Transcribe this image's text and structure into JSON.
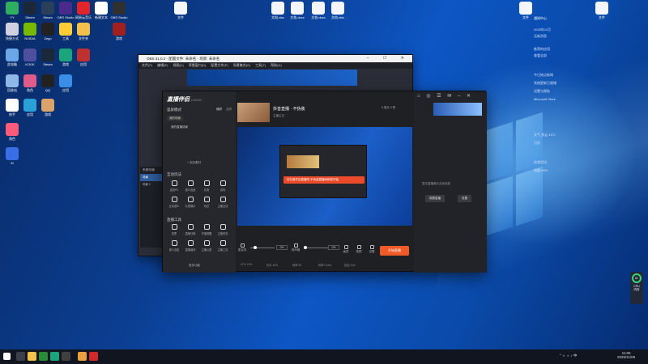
{
  "colors": {
    "accent": "#f05a28",
    "desktop": "#0d56c4",
    "obs_bg": "#2b2e38",
    "helper_bg": "#1f2024"
  },
  "desktop_icons": [
    {
      "label": "YY",
      "color": "#2fae5f"
    },
    {
      "label": "Steam",
      "color": "#1b2838"
    },
    {
      "label": "Steam",
      "color": "#2a3f5a"
    },
    {
      "label": "OBS Studio",
      "color": "#4a2a8a"
    },
    {
      "label": "网易云音乐",
      "color": "#e0262a"
    },
    {
      "label": "新建文本",
      "color": "#ffffff"
    },
    {
      "label": "OBS Studio",
      "color": "#303030"
    },
    {
      "label": "快捷方式",
      "color": "#d0d0e0"
    },
    {
      "label": "NVIDIA",
      "color": "#76b900"
    },
    {
      "label": "Zepp",
      "color": "#222"
    },
    {
      "label": "工具",
      "color": "#ffcc33"
    },
    {
      "label": "文件夹",
      "color": "#f3c14b"
    },
    {
      "label": "游戏",
      "color": "#a02020"
    },
    {
      "label": "此电脑",
      "color": "#6aa6e8"
    },
    {
      "label": "KOOK",
      "color": "#4f4f9f"
    },
    {
      "label": "Steam",
      "color": "#1b2838"
    },
    {
      "label": "游戏",
      "color": "#1aa57a"
    },
    {
      "label": "应用",
      "color": "#c03030"
    },
    {
      "label": "回收站",
      "color": "#8fb8e8"
    },
    {
      "label": "角色",
      "color": "#e05a8a"
    },
    {
      "label": "QQ",
      "color": "#222"
    },
    {
      "label": "应用",
      "color": "#3a8ee6"
    },
    {
      "label": "快手",
      "color": "#fff"
    },
    {
      "label": "应用",
      "color": "#2aa0d8"
    },
    {
      "label": "游戏",
      "color": "#d9a36a"
    },
    {
      "label": "角色",
      "color": "#ff5a7a"
    },
    {
      "label": "M",
      "color": "#3a6ee6"
    }
  ],
  "top_files": [
    {
      "label": "文件"
    },
    {
      "label": "文档.xlsx"
    },
    {
      "label": "文档.docx"
    },
    {
      "label": "文档.docx"
    },
    {
      "label": "文档.xlsx"
    },
    {
      "label": "文件"
    },
    {
      "label": "文件"
    }
  ],
  "obs": {
    "title": "OBS 31.0.2 - 配置文件: 未命名 - 场景: 未命名",
    "menu": [
      "文件(F)",
      "编辑(E)",
      "视图(V)",
      "停靠窗口(D)",
      "配置文件(P)",
      "场景集合(S)",
      "工具(T)",
      "帮助(H)"
    ],
    "scenes_label": "来源/场景",
    "scenes": [
      "场景",
      "场景 2"
    ]
  },
  "helper": {
    "logo": "直播伴侣",
    "version": "v 10.0.0",
    "mode_label": "竖屏模式",
    "mode_tabs": [
      "横屏",
      "竖屏"
    ],
    "scene_tab": "我的场景",
    "scene_item": "我的直播场景",
    "add_material": "+ 添加素材",
    "interaction_title": "互动玩法",
    "interaction_tools": [
      "连线PK",
      "观众连线",
      "礼物",
      "游戏",
      "互动观众",
      "礼物展示",
      "玩法",
      "主播互动"
    ],
    "tools_title": "直播工具",
    "live_tools": [
      "投票",
      "直播日程",
      "开播提醒",
      "主播任务",
      "观众连麦",
      "直播福利",
      "主播心愿",
      "主播工具"
    ],
    "more_features": "更多功能",
    "user_title": "抖音直播 · 不伪装",
    "room_label": "主播主页",
    "stats_label": "0 观众  0 赞",
    "banner": "在抖音开启直播吧 不伪装直播间即将开始",
    "golive": "开始直播",
    "mic_label": "麦克风",
    "speaker_label": "扬声器",
    "mic_pct": "0%",
    "speaker_pct": "0%",
    "controls": [
      "画质",
      "美颜",
      "设置"
    ],
    "statusbar": [
      "CPU 22%",
      "内存 45%",
      "帧率 60",
      "码率 0 kb/s",
      "延迟 0ms"
    ],
    "right_text": "暂无直播观众互动消息",
    "right_btns": [
      "观看直播",
      "设置"
    ]
  },
  "notes": {
    "rows": [
      "通知中心",
      "2025年11月",
      "无新消息",
      "推荐的应用",
      "查看全部",
      "今日热点新闻",
      "系统更新已就绪",
      "设置与隐私",
      "Microsoft Store",
      "天气 多云 15°C",
      "日历",
      "体育资讯",
      "电量 95%"
    ]
  },
  "widget": {
    "value": "61",
    "unit": "%",
    "line1": "CPU",
    "line2": "内存"
  },
  "taskbar": {
    "time": "11:06",
    "date": "2025/11/09"
  }
}
